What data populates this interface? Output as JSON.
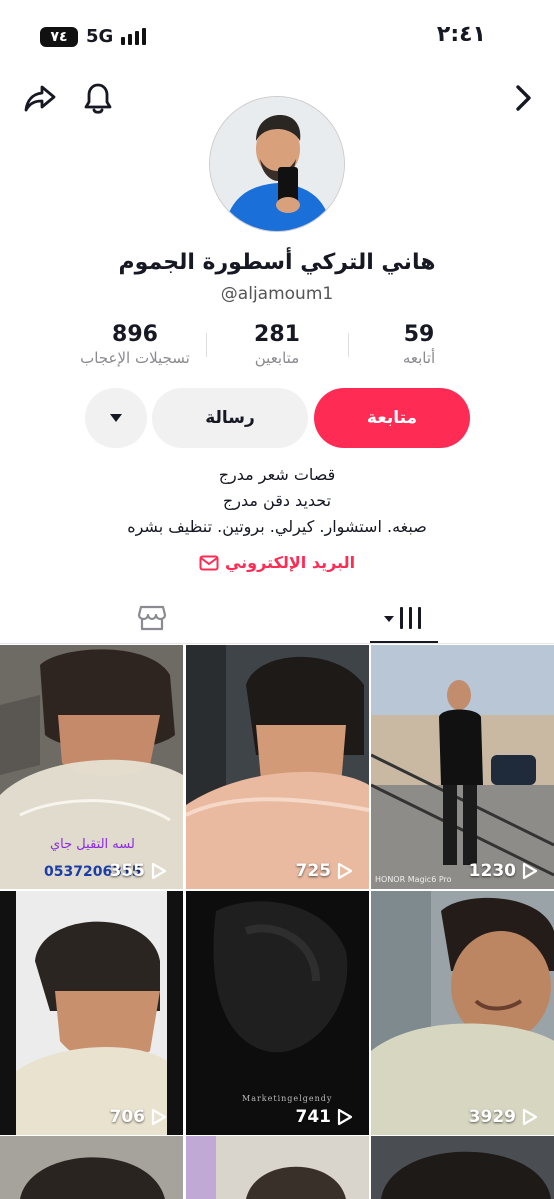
{
  "status_bar": {
    "time": "٢:٤١",
    "network": "5G",
    "battery": "٧٤"
  },
  "profile": {
    "display_name": "هاني التركي أسطورة الجموم",
    "username": "@aljamoum1",
    "stats": {
      "likes": {
        "value": "896",
        "label": "تسجيلات الإعجاب"
      },
      "followers": {
        "value": "281",
        "label": "متابعين"
      },
      "following": {
        "value": "59",
        "label": "أتابعه"
      }
    },
    "buttons": {
      "follow": "متابعة",
      "message": "رسالة"
    },
    "bio": [
      "قصات شعر مدرج",
      "تحديد دقن مدرج",
      "صبغه. استشوار. كيرلي. بروتين. تنظيف بشره"
    ],
    "email_label": "البريد الإلكتروني"
  },
  "tabs": {
    "active": "videos",
    "icons": [
      "videos-grid-icon",
      "shop-icon"
    ]
  },
  "videos": [
    {
      "views": "355",
      "caption_line1": "لسه التقيل جاي",
      "caption_line2": "0537206315"
    },
    {
      "views": "725"
    },
    {
      "views": "1230",
      "watermark": "HONOR Magic6 Pro"
    },
    {
      "views": "706"
    },
    {
      "views": "741",
      "watermark": "Marketingelgendy"
    },
    {
      "views": "3929"
    }
  ],
  "colors": {
    "accent": "#fe2c55",
    "button_gray": "#f1f1f2",
    "text": "#161823",
    "muted": "#8a8b91"
  }
}
